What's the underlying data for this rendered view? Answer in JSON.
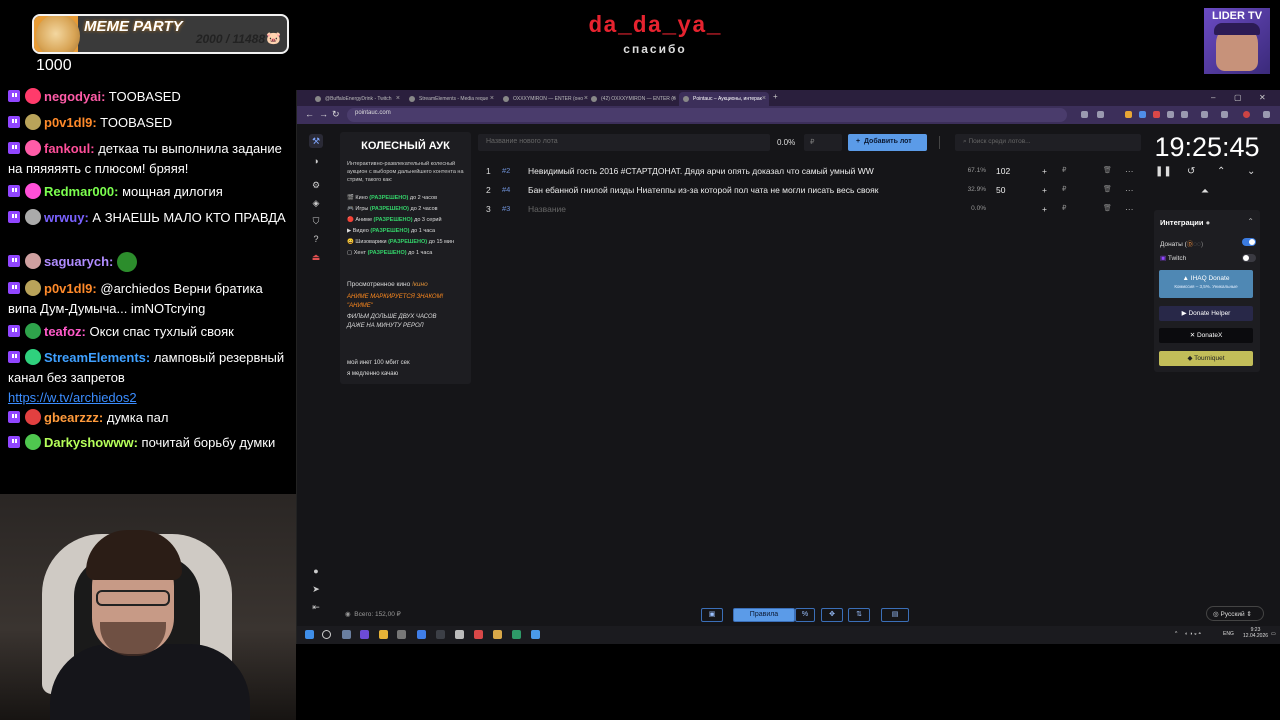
{
  "overlay": {
    "goal_title": "MEME PARTY",
    "goal_progress": "2000 / 11488",
    "goal_fraction": 0.174,
    "goal_count": "1000",
    "alert_name": "da_da_ya_",
    "alert_sub": "спасибо",
    "partner_title": "LIDER TV"
  },
  "chat": [
    {
      "nick": "negodyai:",
      "color": "#ff5ca8",
      "text": "TOOBASED",
      "badge": "#ff3b6b"
    },
    {
      "nick": "p0v1dl9:",
      "color": "#ff8a2a",
      "text": "TOOBASED",
      "badge": "#b9a35a"
    },
    {
      "nick": "fankoul:",
      "color": "#ff4f9a",
      "text": "деткаа ты выполнила задание на пяяяяять с плюсом! бряяя!",
      "badge": "#ff5ca8"
    },
    {
      "nick": "Redmar000:",
      "color": "#7cff4f",
      "text": "мощная дилогия",
      "badge": "#ff4fd8"
    },
    {
      "nick": "wrwuy:",
      "color": "#7a62ff",
      "text": "А ЗНАЕШЬ МАЛО КТО ПРАВДА",
      "badge": "#aaaaaa"
    },
    {
      "nick": "saguarych:",
      "color": "#b08cff",
      "text": "",
      "badge": "#cfa0a0"
    },
    {
      "nick": "p0v1dl9:",
      "color": "#ff8a2a",
      "text": "@archiedos Верни братика випа Дум-Думыча... imNOTcrying",
      "badge": "#b9a35a"
    },
    {
      "nick": "teafoz:",
      "color": "#ff5ac8",
      "text": "Окси спас тухлый свояк",
      "badge": "#2ea34b"
    },
    {
      "nick": "StreamElements:",
      "color": "#3fa0ff",
      "text": "ламповый резервный канал без запретов",
      "link": "https://w.tv/archiedos2",
      "badge": "#2fd17d"
    },
    {
      "nick": "gbearzzz:",
      "color": "#ff9a3b",
      "text": "думка пал",
      "badge": "#e24040"
    },
    {
      "nick": "Darkyshowww:",
      "color": "#b6ff5a",
      "text": "почитай борьбу думки",
      "badge": "#4fc74f"
    }
  ],
  "browser": {
    "tabs": [
      "@BuffaloEnergyDrink - Twitch",
      "StreamElements - Media reque",
      "OXXXYMIRON — ENTER (оно",
      "(42) OXXXYMIRON — ENTER (o",
      "Pointauc – Аукционы, интерак"
    ],
    "url": "pointauc.com"
  },
  "sidebar_rules": {
    "title": "КОЛЕСНЫЙ АУК",
    "desc": "Интерактивно-развлекательный колесный аукцион с выбором дальнейшего контента на стрим, такого как:",
    "rules": [
      {
        "icon": "🎬",
        "name": "Кино",
        "status": "(РАЗРЕШЕНО)",
        "limit": "до 2 часов"
      },
      {
        "icon": "🎮",
        "name": "Игры",
        "status": "(РАЗРЕШЕНО)",
        "limit": "до 2 часов"
      },
      {
        "icon": "🔴",
        "name": "Аниме",
        "status": "(РАЗРЕШЕНО)",
        "limit": "до 3 серий"
      },
      {
        "icon": "▶",
        "name": "Видео",
        "status": "(РАЗРЕШЕНО)",
        "limit": "до 1 часа"
      },
      {
        "icon": "😀",
        "name": "Шизоварики",
        "status": "(РАЗРЕШЕНО)",
        "limit": "до 15 мин"
      },
      {
        "icon": "▢",
        "name": "Хент",
        "status": "(РАЗРЕШЕНО)",
        "limit": "до 1 часа"
      }
    ],
    "watched_label": "Просмотренное кино",
    "watched_link": "!кино",
    "warn1": "АНИМЕ МАРКИРУЕТСЯ ЗНАКОМ!",
    "warn2": "\"АНИМЕ\"",
    "warn3": "ФИЛЬМ ДОЛЬШЕ ДВУХ ЧАСОВ",
    "warn4": "ДАЖЕ НА МИНУТУ РЕРОЛ",
    "foot1": "мой инет 100 мбит сек",
    "foot2": "я медленно качаю"
  },
  "toolbar": {
    "lot_placeholder": "Название нового лота",
    "percent": "0.0%",
    "rub_placeholder": "₽",
    "add_label": "Добавить лот",
    "search_placeholder": "Поиск среди лотов..."
  },
  "lots": [
    {
      "n": "1",
      "id": "#2",
      "name": "Невидимый гость 2016 #СТАРТДОНАТ. Дядя арчи опять доказал что самый умный WW",
      "pct": "67.1%",
      "amount": "102"
    },
    {
      "n": "2",
      "id": "#4",
      "name": "Бан ебанной гнилой пизды Ниатеппы из-за которой пол чата не могли писать весь свояк",
      "pct": "32.9%",
      "amount": "50"
    },
    {
      "n": "3",
      "id": "#3",
      "name": "Название",
      "pct": "0.0%",
      "amount": ""
    }
  ],
  "timer": {
    "value": "19:25:45"
  },
  "integrations": {
    "title": "Интеграции",
    "donations": "Донаты (",
    "twitch": "Twitch",
    "ihaq": "IHAQ Donate",
    "ihaq_sub": "Комиссия – 3,5%. Уникальные",
    "donate_helper": "Donate Helper",
    "donatex": "DonateX",
    "tourniquet": "Tourniquet"
  },
  "bottom": {
    "total": "Всего: 152,00 ₽",
    "rules": "Правила",
    "lang": "Русский"
  },
  "taskbar": {
    "lang": "ENG",
    "time": "9:23",
    "date": "12.04.2026"
  }
}
